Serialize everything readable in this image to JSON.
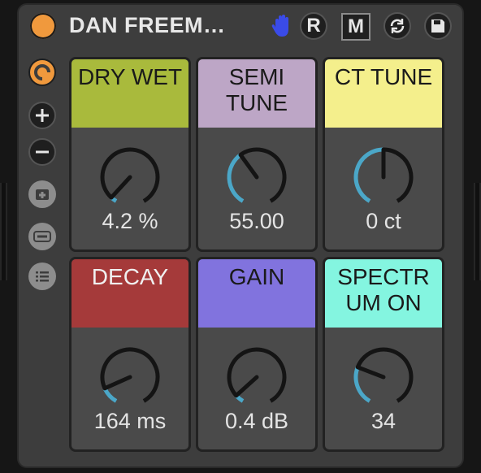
{
  "device": {
    "title": "DAN FREEM…",
    "buttons": {
      "record": "R",
      "mono": "M"
    },
    "colors": {
      "power": "#f0993d",
      "hand": "#3a4be8",
      "knob_arc": "#4ba7c8"
    }
  },
  "left_column": {
    "icons": [
      "hot-swap-icon",
      "plus-icon",
      "minus-icon",
      "add-device-icon",
      "collapse-icon",
      "list-icon"
    ]
  },
  "macros": [
    {
      "label": "DRY WET",
      "value": "4.2 %",
      "color": "#a9ba3c",
      "text_color": "#1a1a1a",
      "level": 0.042
    },
    {
      "label": "SEMI\nTUNE",
      "value": "55.00",
      "color": "#bda6c6",
      "text_color": "#1a1a1a",
      "level": 0.38
    },
    {
      "label": "CT TUNE",
      "value": "0 ct",
      "color": "#f4ef8c",
      "text_color": "#1a1a1a",
      "level": 0.5
    },
    {
      "label": "DECAY",
      "value": "164 ms",
      "color": "#a53a3a",
      "text_color": "#f0f0f0",
      "level": 0.12
    },
    {
      "label": "GAIN",
      "value": "0.4 dB",
      "color": "#8173de",
      "text_color": "#1a1a1a",
      "level": 0.06
    },
    {
      "label": "SPECTR\nUM ON",
      "value": "34",
      "color": "#84f5e0",
      "text_color": "#1a1a1a",
      "level": 0.27
    }
  ]
}
